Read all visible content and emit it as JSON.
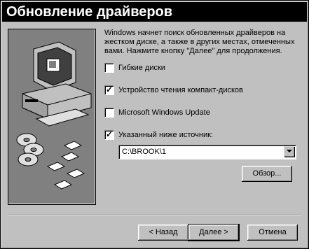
{
  "title": "Обновление драйверов",
  "description": "Windows начнет поиск обновленных драйверов на жестком диске, а также в других местах, отмеченных вами. Нажмите кнопку \"Далее\" для продолжения.",
  "options": [
    {
      "label": "Гибкие диски",
      "checked": false
    },
    {
      "label": "Устройство чтения компакт-дисков",
      "checked": true
    },
    {
      "label": "Microsoft Windows Update",
      "checked": false
    },
    {
      "label": "Указанный ниже источник:",
      "checked": true
    }
  ],
  "path_value": "C:\\BROOK\\1",
  "buttons": {
    "browse": "Обзор...",
    "back": "< Назад",
    "next": "Далее >",
    "cancel": "Отмена"
  },
  "check_mark": "✓",
  "colors": {
    "face": "#c0c0c0",
    "art_bg": "#808080",
    "titlebar": "#000000"
  }
}
